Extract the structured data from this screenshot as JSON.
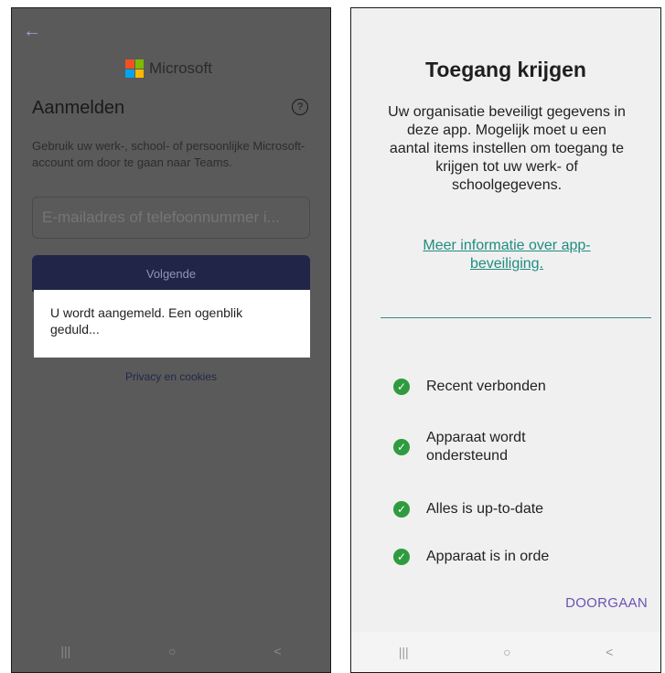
{
  "left": {
    "brand": "Microsoft",
    "title": "Aanmelden",
    "help_icon": "?",
    "description": "Gebruik uw werk-, school- of persoonlijke Microsoft-account om door te gaan naar Teams.",
    "email_placeholder": "E-mailadres of telefoonnummer i...",
    "next_button": "Volgende",
    "dialog_text": "U wordt aangemeld. Een ogenblik geduld...",
    "privacy_link": "Privacy en cookies",
    "logo_colors": [
      "#f25022",
      "#7fba00",
      "#00a4ef",
      "#ffb900"
    ]
  },
  "right": {
    "title": "Toegang krijgen",
    "body": "Uw organisatie beveiligt gegevens in deze app. Mogelijk moet u een aantal items instellen om toegang te krijgen tot uw werk- of schoolgegevens.",
    "link": "Meer informatie over app-beveiliging.",
    "checks": [
      {
        "label": "Recent verbonden"
      },
      {
        "label": "Apparaat wordt ondersteund"
      },
      {
        "label": "Alles is up-to-date"
      },
      {
        "label": "Apparaat is in orde"
      }
    ],
    "continue_button": "DOORGAAN",
    "accent_color": "#1f8c80",
    "check_color": "#2e9b3f"
  },
  "navbar": {
    "recent": "|||",
    "home": "○",
    "back": "<"
  }
}
